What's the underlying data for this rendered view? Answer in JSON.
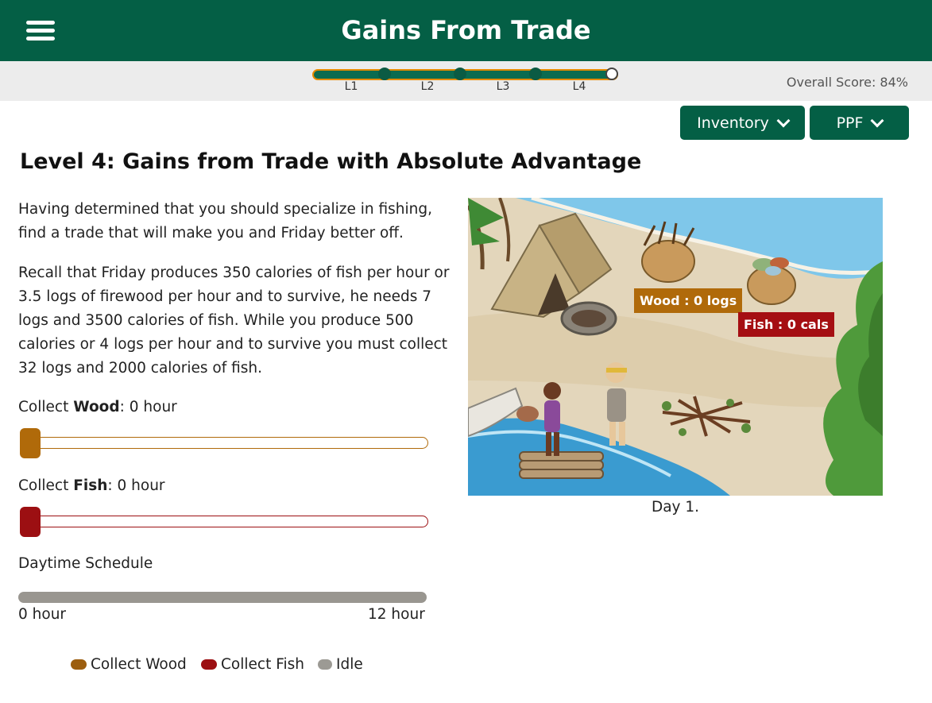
{
  "header": {
    "title": "Gains From Trade",
    "menu_icon": "hamburger-menu-icon"
  },
  "progress": {
    "levels": [
      "L1",
      "L2",
      "L3",
      "L4"
    ],
    "current_level": "L4",
    "overall_score": "Overall Score: 84%"
  },
  "dropdowns": {
    "inventory_label": "Inventory",
    "ppf_label": "PPF"
  },
  "level": {
    "title": "Level 4: Gains from Trade with Absolute Advantage",
    "paragraph1": "Having determined that you should specialize in fishing, find a trade that will make you and Friday better off.",
    "paragraph2": "Recall that Friday produces 350 calories of fish per hour or 3.5 logs of firewood per hour and to survive, he needs 7 logs and 3500 calories of fish. While you produce 500 calories or 4 logs per hour and to survive you must collect 32 logs and 2000 calories of fish."
  },
  "wood_slider": {
    "prefix": "Collect ",
    "bold": "Wood",
    "suffix": ":  0 hour",
    "value_hours": 0,
    "color": "#b06a0a"
  },
  "fish_slider": {
    "prefix": "Collect ",
    "bold": "Fish",
    "suffix": ":  0 hour",
    "value_hours": 0,
    "color": "#9c0f12"
  },
  "schedule": {
    "label": "Daytime Schedule",
    "min_label": "0 hour",
    "max_label": "12 hour"
  },
  "legend": {
    "wood": "Collect Wood",
    "fish": "Collect Fish",
    "idle": "Idle",
    "wood_color": "#9c5e0f",
    "fish_color": "#9c0f12",
    "idle_color": "#9c9a94"
  },
  "scene": {
    "wood_badge": "Wood : 0 logs",
    "fish_badge": "Fish : 0 cals",
    "caption": "Day 1."
  }
}
